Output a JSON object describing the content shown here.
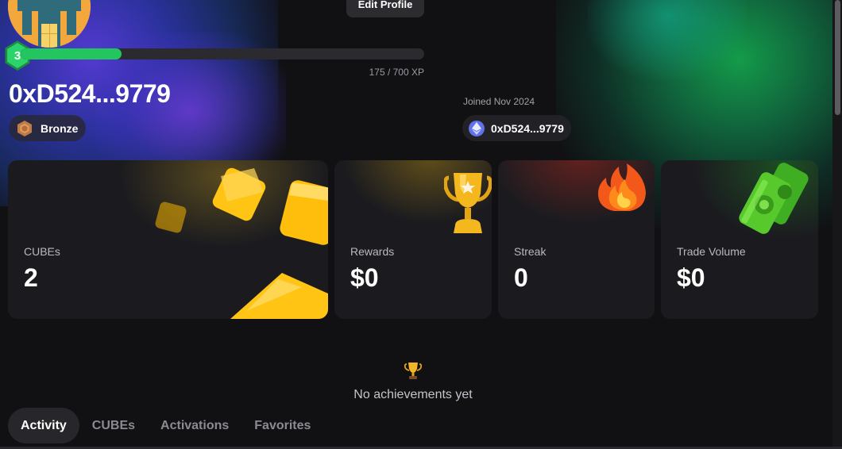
{
  "profile": {
    "edit_label": "Edit Profile",
    "level": "3",
    "xp_text": "175 / 700 XP",
    "xp_progress": 0.25,
    "address": "0xD524...9779",
    "tier": "Bronze",
    "joined": "Joined Nov 2024",
    "wallet": "0xD524...9779"
  },
  "stats": [
    {
      "label": "CUBEs",
      "value": "2"
    },
    {
      "label": "Rewards",
      "value": "$0"
    },
    {
      "label": "Streak",
      "value": "0"
    },
    {
      "label": "Trade Volume",
      "value": "$0"
    }
  ],
  "achievements": {
    "empty_text": "No achievements yet"
  },
  "tabs": [
    {
      "label": "Activity"
    },
    {
      "label": "CUBEs"
    },
    {
      "label": "Activations"
    },
    {
      "label": "Favorites"
    }
  ],
  "colors": {
    "background": "#111114",
    "accent_green": "#22c55e",
    "card": "#1b1b1f"
  },
  "icons": {
    "tier": "bronze-hexagon-icon",
    "wallet": "ethereum-icon",
    "achievements": "trophy-icon",
    "cubes_art": "gold-cubes",
    "rewards_art": "trophy-art",
    "streak_art": "fire-art",
    "volume_art": "money-stack-art"
  }
}
